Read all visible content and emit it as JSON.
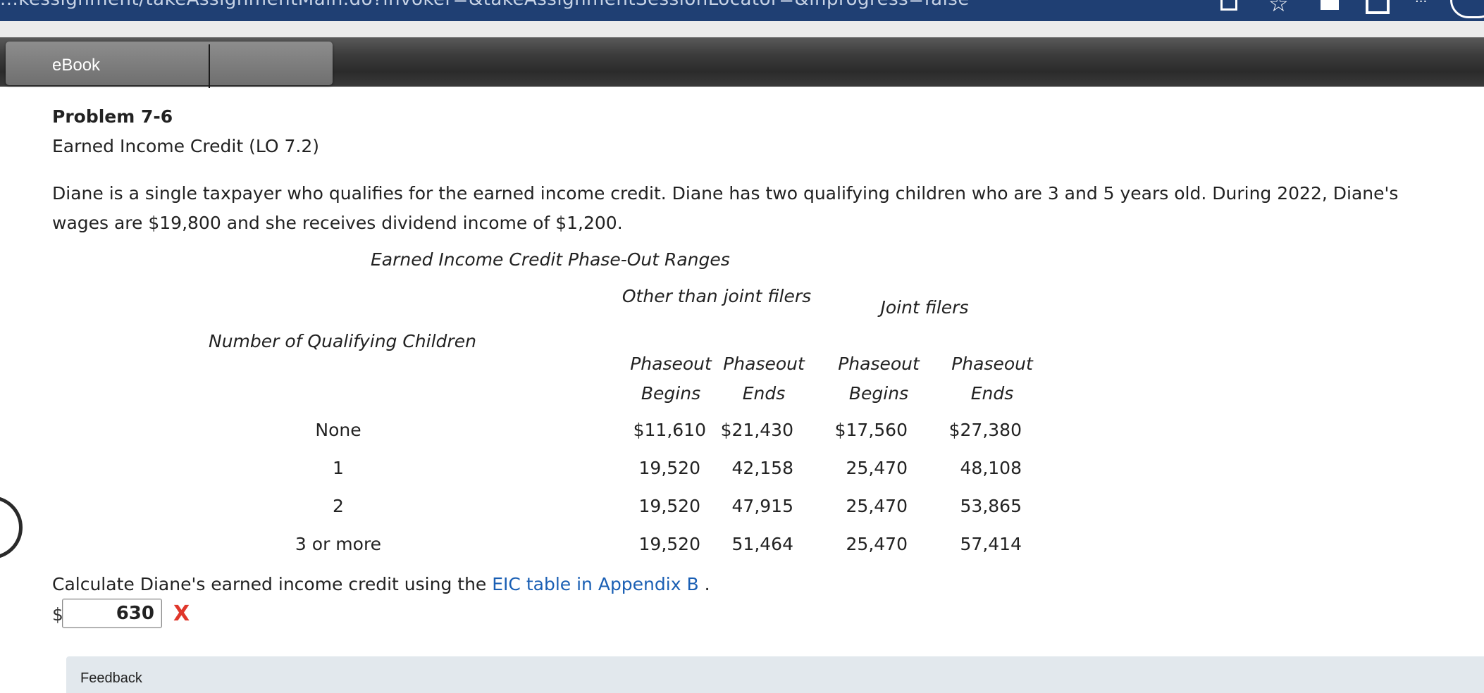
{
  "browser": {
    "url_fragment": "...kessignment/takeAssignmentMain.do?invoker=&takeAssignmentSessionLocator=&inprogress=false"
  },
  "toolbar": {
    "ebook_label": "eBook"
  },
  "problem": {
    "title": "Problem 7-6",
    "subtitle": "Earned Income Credit (LO 7.2)",
    "text": "Diane is a single taxpayer who qualifies for the earned income credit. Diane has two qualifying children who are 3 and 5 years old. During 2022, Diane's wages are $19,800 and she receives dividend income of $1,200."
  },
  "table": {
    "caption": "Earned Income Credit Phase-Out Ranges",
    "header_other": "Other than joint filers",
    "header_joint": "Joint filers",
    "header_number": "Number of Qualifying Children",
    "sub_headers": [
      "Phaseout Begins",
      "Phaseout Ends",
      "Phaseout Begins",
      "Phaseout Ends"
    ],
    "rows": [
      {
        "label": "None",
        "values": [
          "$11,610",
          "$21,430",
          "$17,560",
          "$27,380"
        ]
      },
      {
        "label": "1",
        "values": [
          "19,520",
          "42,158",
          "25,470",
          "48,108"
        ]
      },
      {
        "label": "2",
        "values": [
          "19,520",
          "47,915",
          "25,470",
          "53,865"
        ]
      },
      {
        "label": "3 or more",
        "values": [
          "19,520",
          "51,464",
          "25,470",
          "57,414"
        ]
      }
    ]
  },
  "question": {
    "prefix": "Calculate Diane's earned income credit using the",
    "link": "EIC table in Appendix B",
    "suffix": ".",
    "currency": "$",
    "answer_value": "630",
    "result_mark": "X"
  },
  "feedback": {
    "label": "Feedback"
  }
}
